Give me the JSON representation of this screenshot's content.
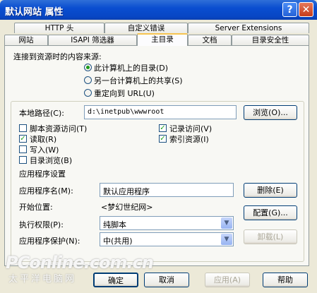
{
  "window": {
    "title": "默认网站 属性",
    "help_label": "?",
    "close_label": "✕"
  },
  "tabs": {
    "row1": [
      "HTTP 头",
      "自定义错误",
      "Server Extensions"
    ],
    "row2": [
      "网站",
      "ISAPI 筛选器",
      "主目录",
      "文档",
      "目录安全性"
    ],
    "active": "主目录"
  },
  "content_source": {
    "label": "连接到资源时的内容来源:",
    "options": [
      "此计算机上的目录(D)",
      "另一台计算机上的共享(S)",
      "重定向到 URL(U)"
    ],
    "selected_index": 0
  },
  "local_path": {
    "label": "本地路径(C):",
    "value": "d:\\inetpub\\wwwroot",
    "browse_label": "浏览(O)..."
  },
  "permissions": [
    {
      "label": "脚本资源访问(T)",
      "checked": false
    },
    {
      "label": "读取(R)",
      "checked": true
    },
    {
      "label": "写入(W)",
      "checked": false
    },
    {
      "label": "目录浏览(B)",
      "checked": false
    },
    {
      "label": "记录访问(V)",
      "checked": true
    },
    {
      "label": "索引资源(I)",
      "checked": true
    }
  ],
  "app_settings": {
    "section_label": "应用程序设置",
    "app_name_label": "应用程序名(M):",
    "app_name_value": "默认应用程序",
    "remove_label": "删除(E)",
    "start_point_label": "开始位置:",
    "start_point_value": "<梦幻世纪网>",
    "config_label": "配置(G)...",
    "exec_perm_label": "执行权限(P):",
    "exec_perm_value": "纯脚本",
    "protection_label": "应用程序保护(N):",
    "protection_value": "中(共用)",
    "unload_label": "卸载(L)"
  },
  "footer": {
    "ok": "确定",
    "cancel": "取消",
    "apply": "应用(A)",
    "help": "帮助"
  },
  "watermark": {
    "brand": "PConline.com.cn",
    "sub": "太平洋电脑网"
  }
}
